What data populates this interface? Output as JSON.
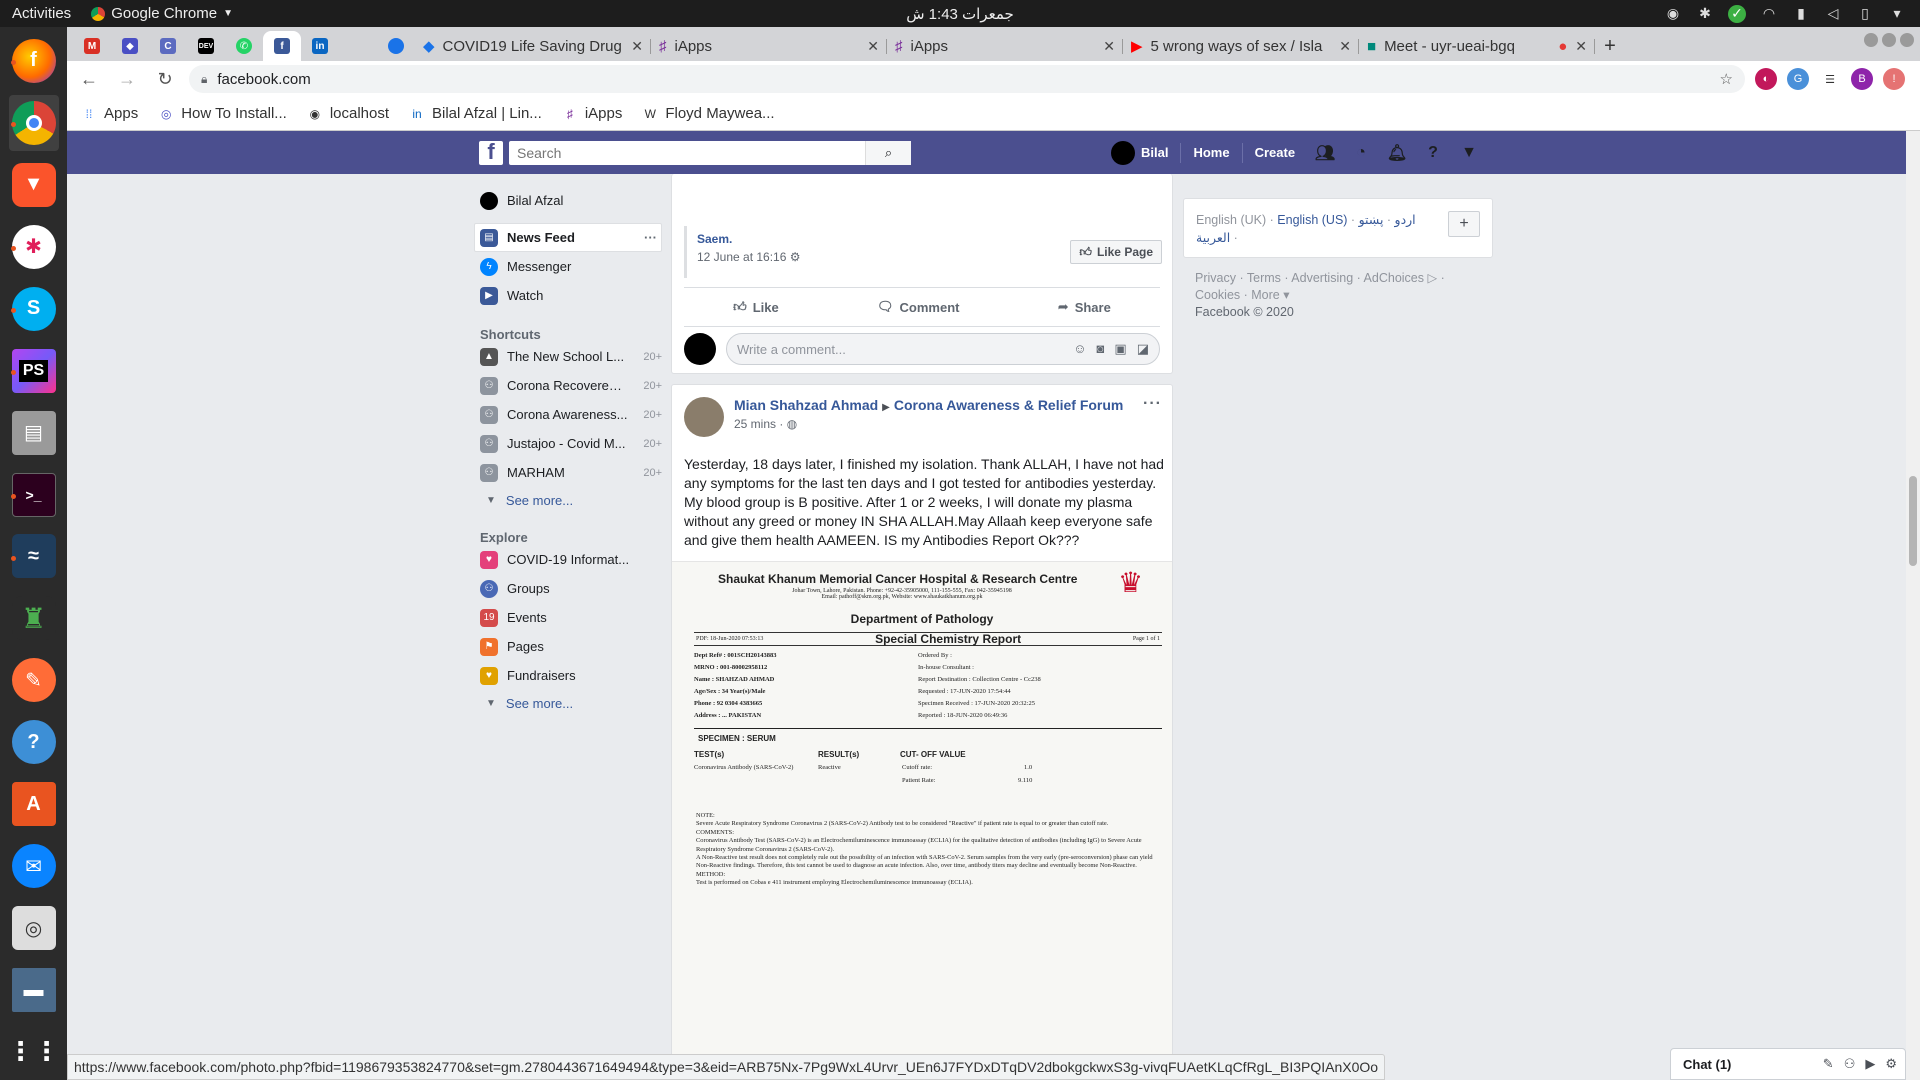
{
  "os": {
    "activities": "Activities",
    "app_name": "Google Chrome",
    "clock": "جمعرات 1:43 ش"
  },
  "browser": {
    "tabs": [
      {
        "title": "COVID19 Life Saving Drug"
      },
      {
        "title": "iApps"
      },
      {
        "title": "iApps"
      },
      {
        "title": "5 wrong ways of sex / Isla"
      },
      {
        "title": "Meet - uyr-ueai-bgq"
      }
    ],
    "url": "facebook.com",
    "bookmarks": [
      "Apps",
      "How To Install...",
      "localhost",
      "Bilal Afzal | Lin...",
      "iApps",
      "Floyd Maywea..."
    ],
    "status_url": "https://www.facebook.com/photo.php?fbid=1198679353824770&set=gm.2780443671649494&type=3&eid=ARB75Nx-7Pg9WxL4Urvr_UEn6J7FYDxDTqDV2dbokgckwxS3g-vivqFUAetKLqCfRgL_BI3PQIAnX0Oo",
    "profile_letter": "B"
  },
  "fb": {
    "search_placeholder": "Search",
    "user": "Bilal",
    "home": "Home",
    "create": "Create",
    "left": {
      "profile": "Bilal Afzal",
      "main": [
        {
          "label": "News Feed",
          "color": "#3b5998"
        },
        {
          "label": "Messenger",
          "color": "#0084ff"
        },
        {
          "label": "Watch",
          "color": "#3b5998"
        }
      ],
      "shortcuts_title": "Shortcuts",
      "shortcuts": [
        {
          "label": "The New School L...",
          "count": "20+"
        },
        {
          "label": "Corona Recovered ...",
          "count": "20+"
        },
        {
          "label": "Corona Awareness...",
          "count": "20+"
        },
        {
          "label": "Justajoo - Covid M...",
          "count": "20+"
        },
        {
          "label": "MARHAM",
          "count": "20+"
        }
      ],
      "see_more": "See more...",
      "explore_title": "Explore",
      "explore": [
        {
          "label": "COVID-19 Informat...",
          "color": "#e4407b"
        },
        {
          "label": "Groups",
          "color": "#4a69b5"
        },
        {
          "label": "Events",
          "color": "#d44b4b"
        },
        {
          "label": "Pages",
          "color": "#f0712c"
        },
        {
          "label": "Fundraisers",
          "color": "#e0a100"
        }
      ],
      "see_more2": "See more..."
    },
    "post1": {
      "shared_name": "Saem.",
      "shared_date": "12 June at 16:16",
      "like_page": "Like Page",
      "like": "Like",
      "comment": "Comment",
      "share": "Share",
      "comment_placeholder": "Write a comment..."
    },
    "post2": {
      "author": "Mian Shahzad Ahmad",
      "group": "Corona Awareness & Relief Forum",
      "time": "25 mins",
      "text": "Yesterday, 18 days later, I finished my isolation. Thank ALLAH, I have not had any symptoms for the last ten days and I got tested for antibodies yesterday. My blood group is B positive. After 1 or 2 weeks, I will donate my plasma without any greed or money IN SHA ALLAH.May Allaah keep everyone safe and give them health AAMEEN. IS my Antibodies Report Ok???",
      "report": {
        "hospital": "Shaukat Khanum Memorial Cancer Hospital & Research Centre",
        "address": "Johar Town, Lahore, Pakistan. Phone: +92-42-35905000, 111-155-555, Fax: 042-35945198",
        "email": "Email: pathoff@skm.org.pk, Website: www.shaukatkhanum.org.pk",
        "department": "Department of Pathology",
        "report_title": "Special Chemistry Report",
        "pdf": "PDF: 18-Jun-2020 07:53:13",
        "page": "Page 1 of 1",
        "left_fields": "Dept Ref# : 001SCH20143883\nMRNO : 001-80002958112\nName : SHAHZAD AHMAD\nAge/Sex : 34 Year(s)/Male\nPhone : 92 0304 4383665\nAddress : ... PAKISTAN",
        "right_fields": "Ordered By :\nIn-house Consultant :\nReport Destination : Collection Centre - Cc238\nRequested : 17-JUN-2020 17:54:44\nSpecimen Received : 17-JUN-2020 20:32:25\nReported : 18-JUN-2020 06:49:36",
        "specimen": "SPECIMEN : SERUM",
        "col_test": "TEST(s)",
        "col_result": "RESULT(s)",
        "col_cutoff": "CUT- OFF VALUE",
        "test": "Coronavirus Antibody (SARS-CoV-2)",
        "result": "Reactive",
        "cutoff_label": "Cutoff rate:",
        "cutoff_value": "1.0",
        "patient_label": "Patient Rate:",
        "patient_value": "9.110",
        "note": "NOTE:\nSevere Acute Respiratory Syndrome Coronavirus 2 (SARS-CoV-2) Antibody test to be considered \"Reactive\" if patient rate is equal to or greater than cutoff rate.\nCOMMENTS:\nCoronavirus Antibody Test (SARS-CoV-2) is an Electrochemiluminescence immunoassay (ECLIA) for the qualitative detection of antibodies (including IgG) to Severe Acute Respiratory Syndrome Coronavirus 2 (SARS-CoV-2).\nA Non-Reactive test result does not completely rule out the possibility of an infection with SARS-CoV-2. Serum samples from the very early (pre-seroconversion) phase can yield Non-Reactive findings. Therefore, this test cannot be used to diagnose an acute infection. Also, over time, antibody titers may decline and eventually become Non-Reactive.\nMETHOD:\nTest is performed on Cobas e 411 instrument employing Electrochemiluminescence immunoassay (ECLIA)."
      }
    },
    "right": {
      "lang1": "English (UK)",
      "lang2": "English (US)",
      "lang3": "اردو",
      "lang4": "پښتو",
      "lang5": "العربية",
      "footer1": "Privacy · Terms · Advertising · AdChoices ▷ ·",
      "footer2": "Cookies · More ▾",
      "copyright": "Facebook © 2020"
    },
    "chat": "Chat (1)"
  }
}
